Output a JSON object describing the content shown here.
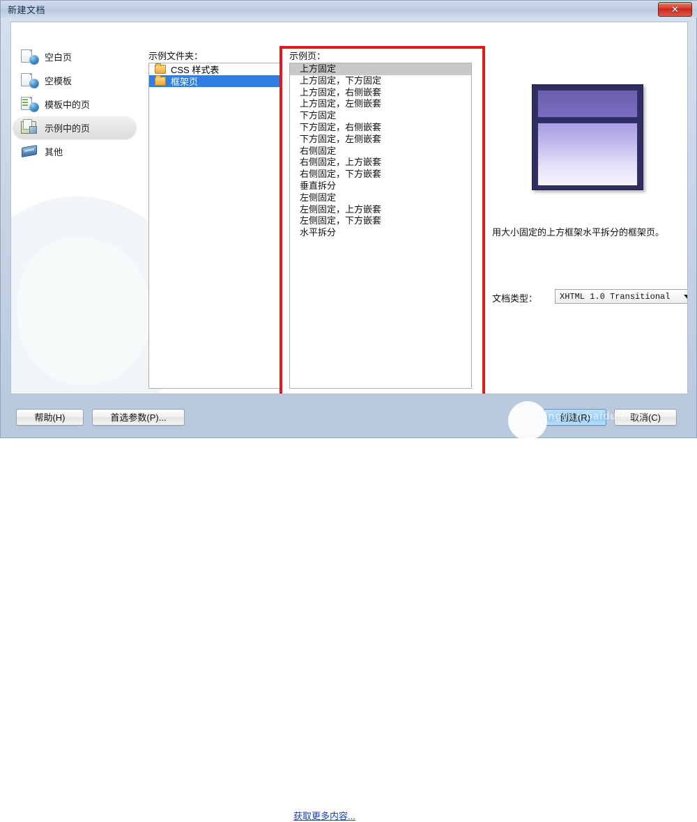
{
  "window": {
    "title": "新建文档",
    "close_label": "✕"
  },
  "sidebar": {
    "items": [
      {
        "label": "空白页",
        "icon": "blank-page-icon",
        "selected": false
      },
      {
        "label": "空模板",
        "icon": "blank-template-icon",
        "selected": false
      },
      {
        "label": "模板中的页",
        "icon": "page-from-template-icon",
        "selected": false
      },
      {
        "label": "示例中的页",
        "icon": "page-from-sample-icon",
        "selected": true
      },
      {
        "label": "其他",
        "icon": "other-icon",
        "selected": false
      }
    ]
  },
  "folders": {
    "label": "示例文件夹：",
    "items": [
      {
        "label": "CSS 样式表",
        "selected": false
      },
      {
        "label": "框架页",
        "selected": true
      }
    ]
  },
  "samples": {
    "label": "示例页：",
    "items": [
      {
        "label": "上方固定",
        "selected": true
      },
      {
        "label": "上方固定，下方固定",
        "selected": false
      },
      {
        "label": "上方固定，右侧嵌套",
        "selected": false
      },
      {
        "label": "上方固定，左侧嵌套",
        "selected": false
      },
      {
        "label": "下方固定",
        "selected": false
      },
      {
        "label": "下方固定，右侧嵌套",
        "selected": false
      },
      {
        "label": "下方固定，左侧嵌套",
        "selected": false
      },
      {
        "label": "右侧固定",
        "selected": false
      },
      {
        "label": "右侧固定，上方嵌套",
        "selected": false
      },
      {
        "label": "右侧固定，下方嵌套",
        "selected": false
      },
      {
        "label": "垂直拆分",
        "selected": false
      },
      {
        "label": "左侧固定",
        "selected": false
      },
      {
        "label": "左侧固定，上方嵌套",
        "selected": false
      },
      {
        "label": "左侧固定，下方嵌套",
        "selected": false
      },
      {
        "label": "水平拆分",
        "selected": false
      }
    ]
  },
  "preview": {
    "description": "用大小固定的上方框架水平拆分的框架页。",
    "thumbnail_colors": {
      "border": "#2e2e63",
      "top_frame": "#6b5fae",
      "main_frame": "#b3abea"
    }
  },
  "doctype": {
    "label": "文档类型：",
    "value": "XHTML 1.0 Transitional"
  },
  "footer": {
    "help_label": "帮助(H)",
    "preferences_label": "首选参数(P)...",
    "more_content_link": "获取更多内容...",
    "create_label": "创建(R)",
    "cancel_label": "取消(C)"
  },
  "watermark": {
    "text": "jingyan.baidu.com"
  },
  "colors": {
    "accent": "#2f7fe0",
    "red_highlight": "#e61919",
    "link": "#1a3fb8"
  }
}
